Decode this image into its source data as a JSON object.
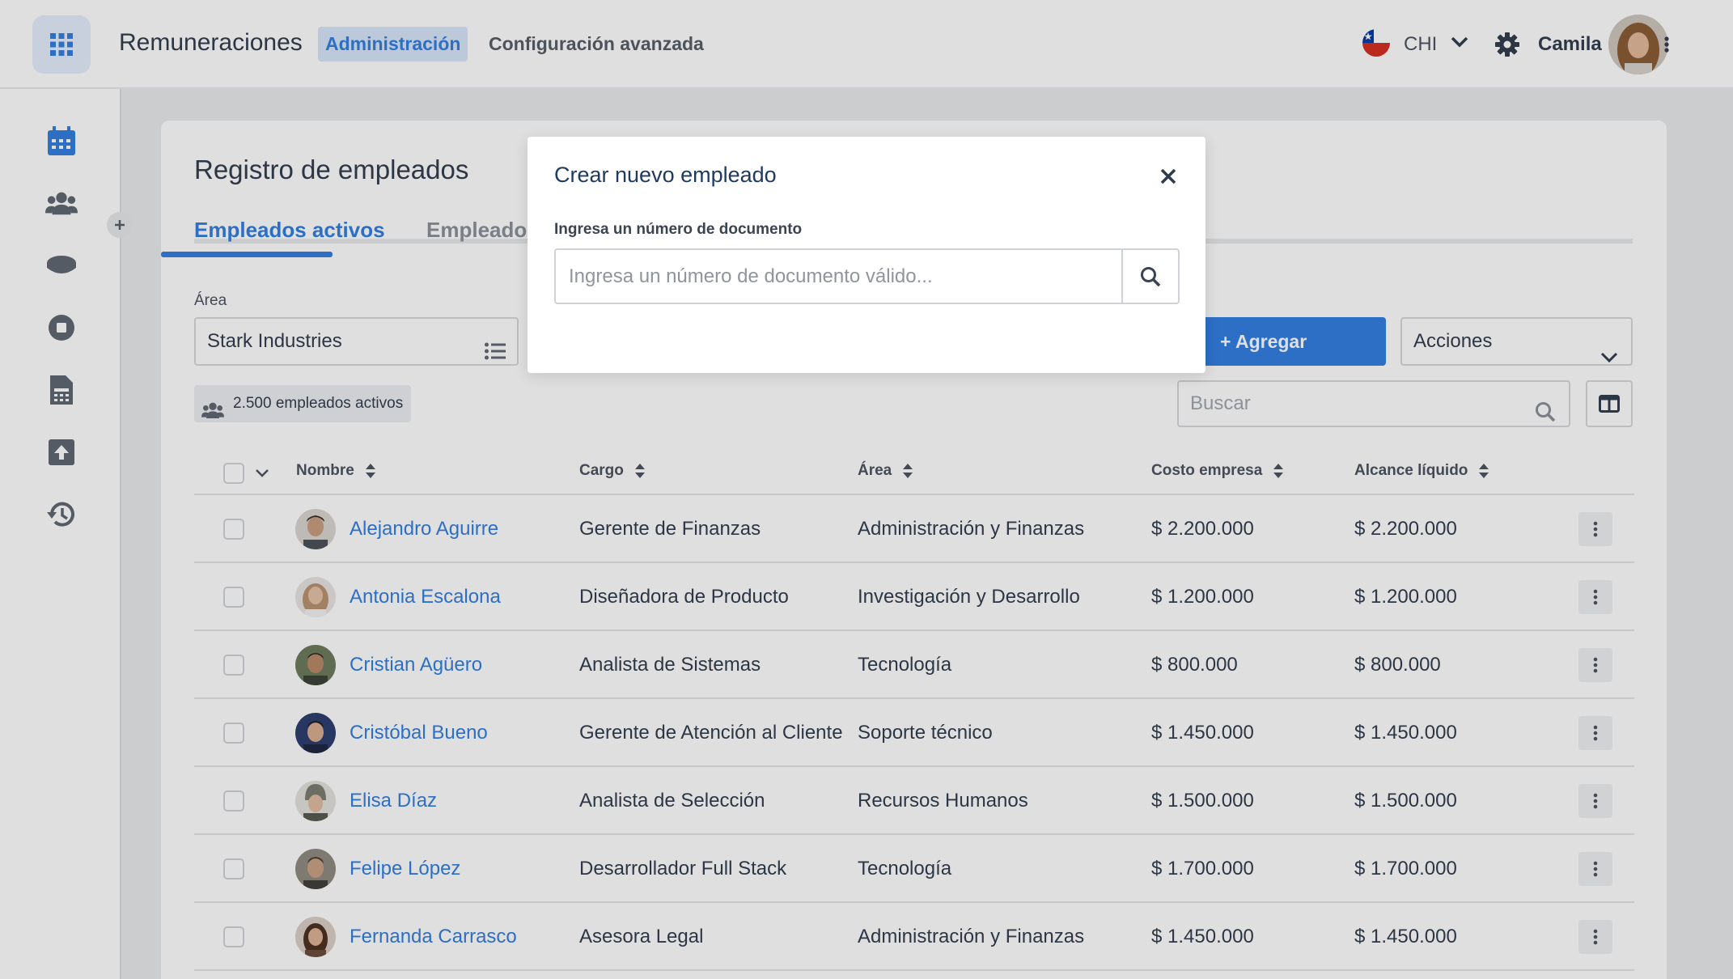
{
  "header": {
    "app_title": "Remuneraciones",
    "nav_admin": "Administración",
    "nav_config": "Configuración avanzada",
    "country": "CHI",
    "user_name": "Camila"
  },
  "page": {
    "title": "Registro de empleados",
    "tabs": [
      {
        "label": "Empleados activos",
        "active": true
      },
      {
        "label": "Empleados ina",
        "active": false
      }
    ],
    "area_label": "Área",
    "area_value": "Stark Industries",
    "count_badge": "2.500 empleados activos",
    "add_button": "+ Agregar empleado",
    "actions_select": "Acciones",
    "search_placeholder": "Buscar"
  },
  "table": {
    "columns": [
      "Nombre",
      "Cargo",
      "Área",
      "Costo empresa",
      "Alcance líquido"
    ],
    "rows": [
      {
        "nombre": "Alejandro Aguirre",
        "cargo": "Gerente de Finanzas",
        "area": "Administración y Finanzas",
        "costo": "$ 2.200.000",
        "alcance": "$ 2.200.000"
      },
      {
        "nombre": "Antonia Escalona",
        "cargo": "Diseñadora de Producto",
        "area": "Investigación y Desarrollo",
        "costo": "$ 1.200.000",
        "alcance": "$ 1.200.000"
      },
      {
        "nombre": "Cristian Agüero",
        "cargo": "Analista de Sistemas",
        "area": "Tecnología",
        "costo": "$ 800.000",
        "alcance": "$ 800.000"
      },
      {
        "nombre": "Cristóbal Bueno",
        "cargo": "Gerente de Atención al Cliente",
        "area": "Soporte técnico",
        "costo": "$ 1.450.000",
        "alcance": "$ 1.450.000"
      },
      {
        "nombre": "Elisa Díaz",
        "cargo": "Analista de Selección",
        "area": "Recursos Humanos",
        "costo": "$ 1.500.000",
        "alcance": "$ 1.500.000"
      },
      {
        "nombre": "Felipe López",
        "cargo": "Desarrollador Full Stack",
        "area": "Tecnología",
        "costo": "$ 1.700.000",
        "alcance": "$ 1.700.000"
      },
      {
        "nombre": "Fernanda Carrasco",
        "cargo": "Asesora Legal",
        "area": "Administración y Finanzas",
        "costo": "$ 1.450.000",
        "alcance": "$ 1.450.000"
      }
    ]
  },
  "modal": {
    "title": "Crear nuevo empleado",
    "label": "Ingresa un número de documento",
    "placeholder": "Ingresa un número de documento válido..."
  },
  "colors": {
    "accent": "#2f7de1",
    "accent_light": "#d7e6fb",
    "text_dark": "#2f3b4c",
    "overlay": "rgba(30,30,30,0.14)"
  }
}
